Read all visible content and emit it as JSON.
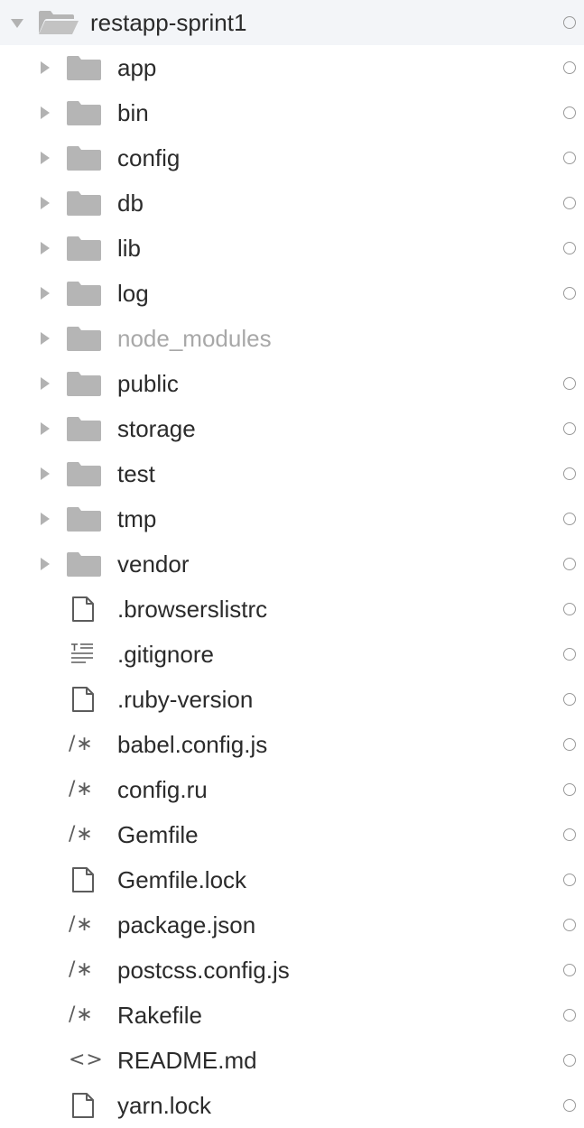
{
  "tree": {
    "root": {
      "label": "restapp-sprint1",
      "icon": "folder-open-icon",
      "expanded": true,
      "status": "circle"
    },
    "items": [
      {
        "label": "app",
        "kind": "folder",
        "icon": "folder-icon",
        "dimmed": false,
        "status": "circle"
      },
      {
        "label": "bin",
        "kind": "folder",
        "icon": "folder-icon",
        "dimmed": false,
        "status": "circle"
      },
      {
        "label": "config",
        "kind": "folder",
        "icon": "folder-icon",
        "dimmed": false,
        "status": "circle"
      },
      {
        "label": "db",
        "kind": "folder",
        "icon": "folder-icon",
        "dimmed": false,
        "status": "circle"
      },
      {
        "label": "lib",
        "kind": "folder",
        "icon": "folder-icon",
        "dimmed": false,
        "status": "circle"
      },
      {
        "label": "log",
        "kind": "folder",
        "icon": "folder-icon",
        "dimmed": false,
        "status": "circle"
      },
      {
        "label": "node_modules",
        "kind": "folder",
        "icon": "folder-icon",
        "dimmed": true,
        "status": "none"
      },
      {
        "label": "public",
        "kind": "folder",
        "icon": "folder-icon",
        "dimmed": false,
        "status": "circle"
      },
      {
        "label": "storage",
        "kind": "folder",
        "icon": "folder-icon",
        "dimmed": false,
        "status": "circle"
      },
      {
        "label": "test",
        "kind": "folder",
        "icon": "folder-icon",
        "dimmed": false,
        "status": "circle"
      },
      {
        "label": "tmp",
        "kind": "folder",
        "icon": "folder-icon",
        "dimmed": false,
        "status": "circle"
      },
      {
        "label": "vendor",
        "kind": "folder",
        "icon": "folder-icon",
        "dimmed": false,
        "status": "circle"
      },
      {
        "label": ".browserslistrc",
        "kind": "file",
        "icon": "file-icon",
        "dimmed": false,
        "status": "circle"
      },
      {
        "label": ".gitignore",
        "kind": "file",
        "icon": "text-file-icon",
        "dimmed": false,
        "status": "circle"
      },
      {
        "label": ".ruby-version",
        "kind": "file",
        "icon": "file-icon",
        "dimmed": false,
        "status": "circle"
      },
      {
        "label": "babel.config.js",
        "kind": "file",
        "icon": "code-comment-icon",
        "glyph": "/∗",
        "dimmed": false,
        "status": "circle"
      },
      {
        "label": "config.ru",
        "kind": "file",
        "icon": "code-comment-icon",
        "glyph": "/∗",
        "dimmed": false,
        "status": "circle"
      },
      {
        "label": "Gemfile",
        "kind": "file",
        "icon": "code-comment-icon",
        "glyph": "/∗",
        "dimmed": false,
        "status": "circle"
      },
      {
        "label": "Gemfile.lock",
        "kind": "file",
        "icon": "file-icon",
        "dimmed": false,
        "status": "circle"
      },
      {
        "label": "package.json",
        "kind": "file",
        "icon": "code-comment-icon",
        "glyph": "/∗",
        "dimmed": false,
        "status": "circle"
      },
      {
        "label": "postcss.config.js",
        "kind": "file",
        "icon": "code-comment-icon",
        "glyph": "/∗",
        "dimmed": false,
        "status": "circle"
      },
      {
        "label": "Rakefile",
        "kind": "file",
        "icon": "code-comment-icon",
        "glyph": "/∗",
        "dimmed": false,
        "status": "circle"
      },
      {
        "label": "README.md",
        "kind": "file",
        "icon": "markup-icon",
        "glyph": "<>",
        "dimmed": false,
        "status": "circle"
      },
      {
        "label": "yarn.lock",
        "kind": "file",
        "icon": "file-icon",
        "dimmed": false,
        "status": "circle"
      }
    ]
  },
  "colors": {
    "text": "#2b2b2b",
    "dimmed_text": "#a8a8a8",
    "folder": "#b5b5b5",
    "caret": "#b2b2b2",
    "status_ring": "#9a9a9a"
  }
}
